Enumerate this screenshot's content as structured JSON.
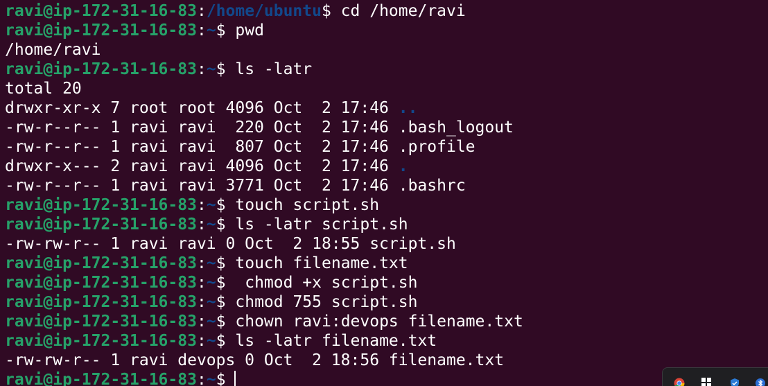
{
  "terminal": {
    "prompt": {
      "user_host": "ravi@ip-172-31-16-83",
      "colon": ":",
      "dollar": "$"
    },
    "lines": [
      {
        "type": "prompt",
        "path": "/home/ubuntu",
        "command": " cd /home/ravi"
      },
      {
        "type": "prompt",
        "path": "~",
        "command": " pwd"
      },
      {
        "type": "output",
        "text": "/home/ravi"
      },
      {
        "type": "prompt",
        "path": "~",
        "command": " ls -latr"
      },
      {
        "type": "output",
        "text": "total 20"
      },
      {
        "type": "listing",
        "text": "drwxr-xr-x 7 root root 4096 Oct  2 17:46 ",
        "name": "..",
        "is_dir": true
      },
      {
        "type": "listing",
        "text": "-rw-r--r-- 1 ravi ravi  220 Oct  2 17:46 ",
        "name": ".bash_logout",
        "is_dir": false
      },
      {
        "type": "listing",
        "text": "-rw-r--r-- 1 ravi ravi  807 Oct  2 17:46 ",
        "name": ".profile",
        "is_dir": false
      },
      {
        "type": "listing",
        "text": "drwxr-x--- 2 ravi ravi 4096 Oct  2 17:46 ",
        "name": ".",
        "is_dir": true
      },
      {
        "type": "listing",
        "text": "-rw-r--r-- 1 ravi ravi 3771 Oct  2 17:46 ",
        "name": ".bashrc",
        "is_dir": false
      },
      {
        "type": "prompt",
        "path": "~",
        "command": " touch script.sh"
      },
      {
        "type": "prompt",
        "path": "~",
        "command": " ls -latr script.sh"
      },
      {
        "type": "output",
        "text": "-rw-rw-r-- 1 ravi ravi 0 Oct  2 18:55 script.sh"
      },
      {
        "type": "prompt",
        "path": "~",
        "command": " touch filename.txt"
      },
      {
        "type": "prompt",
        "path": "~",
        "command": "  chmod +x script.sh"
      },
      {
        "type": "prompt",
        "path": "~",
        "command": " chmod 755 script.sh"
      },
      {
        "type": "prompt",
        "path": "~",
        "command": " chown ravi:devops filename.txt"
      },
      {
        "type": "prompt",
        "path": "~",
        "command": " ls -latr filename.txt"
      },
      {
        "type": "output",
        "text": "-rw-rw-r-- 1 ravi devops 0 Oct  2 18:56 filename.txt"
      },
      {
        "type": "input",
        "path": "~",
        "command": ""
      }
    ]
  },
  "colors": {
    "background": "#300a24",
    "prompt_user": "#26a269",
    "prompt_path": "#12488b",
    "text": "#ffffff"
  },
  "taskbar": {
    "icons": [
      "chrome-icon",
      "start-icon",
      "shield-icon",
      "bluetooth-icon"
    ]
  }
}
